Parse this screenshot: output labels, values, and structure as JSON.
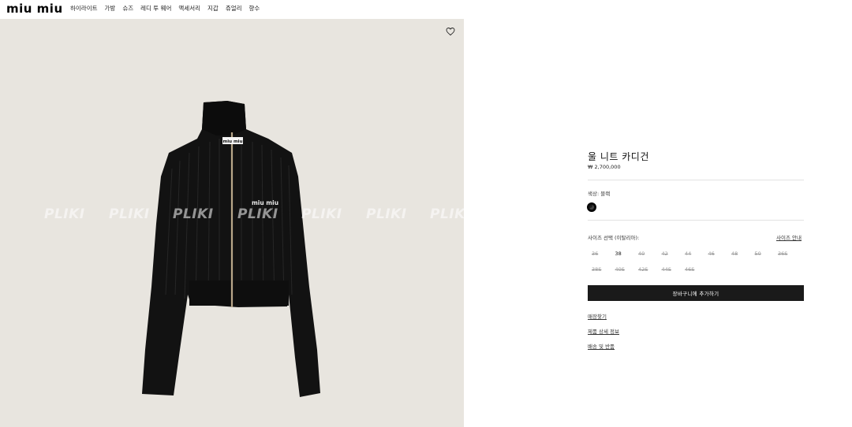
{
  "header": {
    "logo": "miu miu",
    "nav": [
      "하이라이트",
      "가방",
      "슈즈",
      "레디 투 웨어",
      "액세서리",
      "지갑",
      "쥬얼리",
      "향수"
    ]
  },
  "image": {
    "watermark": "PLIKI",
    "garment_logo": "miu miu",
    "favorite_icon": "heart-icon"
  },
  "product": {
    "title": "울 니트 카디건",
    "price": "₩ 2,700,000",
    "color_label": "색상: 블랙",
    "color_swatch": "#0b0b0b",
    "size_label": "사이즈 선택 (이탈리아):",
    "size_guide": "사이즈 안내",
    "sizes_row1": [
      {
        "label": "36",
        "available": false
      },
      {
        "label": "38",
        "available": true
      },
      {
        "label": "40",
        "available": false
      },
      {
        "label": "42",
        "available": false
      },
      {
        "label": "44",
        "available": false
      },
      {
        "label": "46",
        "available": false
      },
      {
        "label": "48",
        "available": false
      },
      {
        "label": "50",
        "available": false
      },
      {
        "label": "36S",
        "available": false
      }
    ],
    "sizes_row2": [
      {
        "label": "38S",
        "available": false
      },
      {
        "label": "40S",
        "available": false
      },
      {
        "label": "42S",
        "available": false
      },
      {
        "label": "44S",
        "available": false
      },
      {
        "label": "46S",
        "available": false
      }
    ],
    "add_to_cart": "장바구니에 추가하기",
    "links": [
      "매장찾기",
      "제품 상세 정보",
      "배송 및 반품"
    ]
  }
}
